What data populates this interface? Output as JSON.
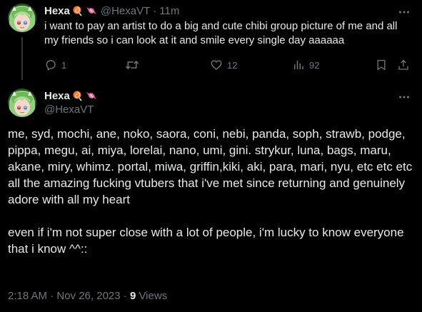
{
  "reply_tweet": {
    "display_name": "Hexa",
    "handle": "@HexaVT",
    "separator": "·",
    "time": "11m",
    "text": "i want to pay an artist to do a big and cute chibi group picture of me and all my friends so i can look at it and smile every single day aaaaaa",
    "actions": {
      "replies": "1",
      "reposts": "",
      "likes": "12",
      "views": "92"
    }
  },
  "main_tweet": {
    "display_name": "Hexa",
    "handle": "@HexaVT",
    "text": "me, syd, mochi, ane, noko, saora, coni, nebi, panda, soph, strawb, podge, pippa, megu, ai, miya, lorelai, nano, umi, gini. strykur, luna, bags, maru, akane, miry, whimz. portal, miwa, griffin,kiki, aki, para, mari, nyu, etc etc etc\nall the amazing fucking vtubers that i've met since returning and genuinely adore with all my heart\n\neven if i'm not super close with a lot of people, i'm lucky to know everyone that i know ^^::",
    "timestamp": "2:18 AM · Nov 26, 2023 ·",
    "views_count": "9",
    "views_label": "Views"
  },
  "icons": {
    "badge_1": "lollipop-icon",
    "badge_2": "wrapped-candy-icon",
    "more": "more-icon",
    "reply": "reply-icon",
    "repost": "repost-icon",
    "like": "heart-icon",
    "views": "views-chart-icon",
    "bookmark": "bookmark-icon",
    "share": "share-icon"
  },
  "colors": {
    "background": "#000000",
    "text_primary": "#e7e9ea",
    "text_secondary": "#71767b",
    "thread_line": "#333639"
  }
}
